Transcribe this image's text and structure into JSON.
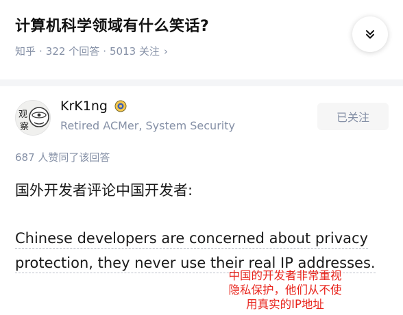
{
  "question": {
    "title": "计算机科学领域有什么笑话?",
    "source": "知乎",
    "answers": "322 个回答",
    "followers": "5013 关注",
    "meta_chevron": "›"
  },
  "author": {
    "name": "KrK1ng",
    "bio": "Retired ACMer, System Security",
    "follow_label": "已关注",
    "avatar_text": [
      "观",
      "察"
    ]
  },
  "answer": {
    "votes": "687 人赞同了该回答",
    "line1": "国外开发者评论中国开发者:",
    "line2": "Chinese developers are concerned about privacy",
    "line3": "protection, they never use their real IP addresses."
  },
  "annotation": {
    "line1": "中国的开发者非常重视",
    "line2": "隐私保护，他们从不使",
    "line3": "用真实的IP地址"
  },
  "colors": {
    "meta_gray": "#8590a6",
    "annotation_red": "#e8251d",
    "divider": "#f4f5f7"
  },
  "icons": {
    "collapse": "double-chevron-down-icon",
    "meta_arrow": "chevron-right-icon",
    "badge": "achievement-badge-icon"
  }
}
